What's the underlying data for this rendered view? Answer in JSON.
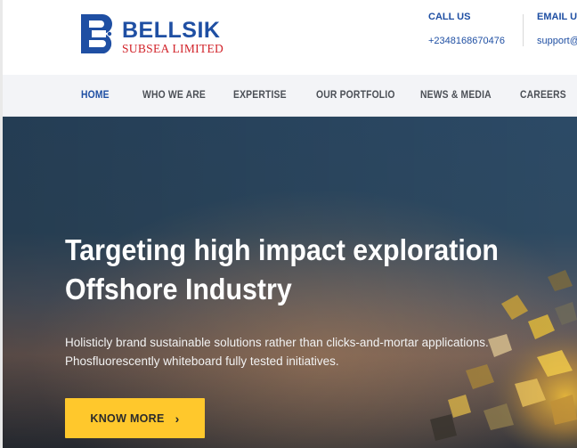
{
  "brand": {
    "name": "BELLSIK",
    "subtitle": "SUBSEA LIMITED",
    "colors": {
      "primary": "#1f4fa3",
      "accent": "#d2232a",
      "cta": "#ffc82c"
    }
  },
  "contact": {
    "call_label": "CALL US",
    "call_value": "+2348168670476",
    "email_label": "EMAIL US",
    "email_value": "support@"
  },
  "nav": {
    "items": [
      {
        "label": "HOME",
        "active": true
      },
      {
        "label": "WHO WE ARE"
      },
      {
        "label": "EXPERTISE"
      },
      {
        "label": "OUR PORTFOLIO"
      },
      {
        "label": "NEWS & MEDIA"
      },
      {
        "label": "CAREERS"
      }
    ]
  },
  "hero": {
    "title_line1": "Targeting high impact exploration",
    "title_line2": "Offshore Industry",
    "text_line1": "Holisticly brand sustainable solutions rather than clicks-and-mortar applications.",
    "text_line2": "Phosfluorescently whiteboard fully tested initiatives.",
    "cta_label": "KNOW MORE",
    "cta_icon": "chevron-right-icon"
  }
}
